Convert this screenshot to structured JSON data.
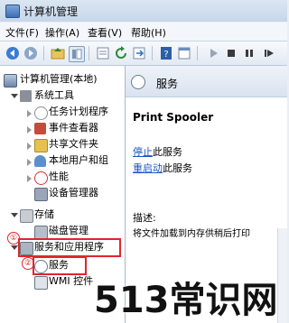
{
  "window": {
    "title": "计算机管理"
  },
  "menu": [
    "文件(F)",
    "操作(A)",
    "查看(V)",
    "帮助(H)"
  ],
  "tree": {
    "root": "计算机管理(本地)",
    "system_tools": "系统工具",
    "task_scheduler": "任务计划程序",
    "event_viewer": "事件查看器",
    "shared_folders": "共享文件夹",
    "local_users": "本地用户和组",
    "performance": "性能",
    "device_manager": "设备管理器",
    "storage": "存储",
    "disk_management": "磁盘管理",
    "services_apps": "服务和应用程序",
    "services": "服务",
    "wmi": "WMI 控件"
  },
  "annotations": {
    "one": "①",
    "two": "②"
  },
  "right": {
    "header": "服务",
    "service_name": "Print Spooler",
    "stop_link": "停止",
    "stop_rest": "此服务",
    "restart_link": "重启动",
    "restart_rest": "此服务",
    "desc_label": "描述:",
    "desc_text": "将文件加载到内存供稍后打印"
  },
  "watermark": "513常识网",
  "colors": {
    "annotation_red": "#e0262b",
    "link_blue": "#1a55c7"
  }
}
